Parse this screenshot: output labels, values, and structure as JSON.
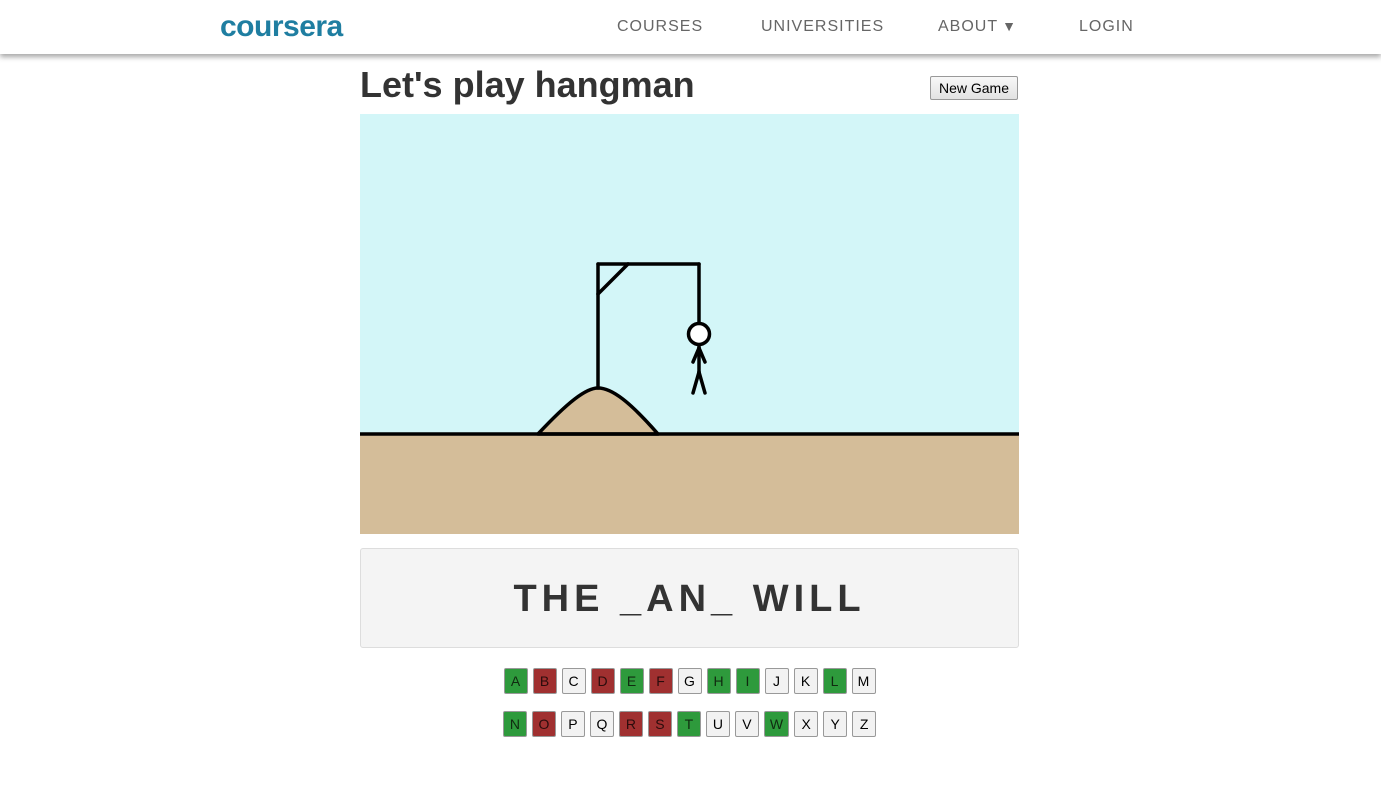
{
  "header": {
    "logo": "coursera",
    "nav": {
      "courses": "COURSES",
      "universities": "UNIVERSITIES",
      "about": "ABOUT",
      "about_caret": "▼",
      "login": "LOGIN"
    }
  },
  "game": {
    "title": "Let's play hangman",
    "new_game_label": "New Game",
    "word": "THE _AN_ WILL",
    "wrong_guesses": 9,
    "colors": {
      "sky": "#d3f6f8",
      "ground": "#d4bd99",
      "correct": "#2e9a3c",
      "wrong": "#a03030",
      "unused": "#f2f2f2",
      "brand": "#1f7ea1"
    },
    "letters_row1": [
      {
        "letter": "A",
        "state": "correct"
      },
      {
        "letter": "B",
        "state": "wrong"
      },
      {
        "letter": "C",
        "state": "unused"
      },
      {
        "letter": "D",
        "state": "wrong"
      },
      {
        "letter": "E",
        "state": "correct"
      },
      {
        "letter": "F",
        "state": "wrong"
      },
      {
        "letter": "G",
        "state": "unused"
      },
      {
        "letter": "H",
        "state": "correct"
      },
      {
        "letter": "I",
        "state": "correct"
      },
      {
        "letter": "J",
        "state": "unused"
      },
      {
        "letter": "K",
        "state": "unused"
      },
      {
        "letter": "L",
        "state": "correct"
      },
      {
        "letter": "M",
        "state": "unused"
      }
    ],
    "letters_row2": [
      {
        "letter": "N",
        "state": "correct"
      },
      {
        "letter": "O",
        "state": "wrong"
      },
      {
        "letter": "P",
        "state": "unused"
      },
      {
        "letter": "Q",
        "state": "unused"
      },
      {
        "letter": "R",
        "state": "wrong"
      },
      {
        "letter": "S",
        "state": "wrong"
      },
      {
        "letter": "T",
        "state": "correct"
      },
      {
        "letter": "U",
        "state": "unused"
      },
      {
        "letter": "V",
        "state": "unused"
      },
      {
        "letter": "W",
        "state": "correct"
      },
      {
        "letter": "X",
        "state": "unused"
      },
      {
        "letter": "Y",
        "state": "unused"
      },
      {
        "letter": "Z",
        "state": "unused"
      }
    ]
  }
}
